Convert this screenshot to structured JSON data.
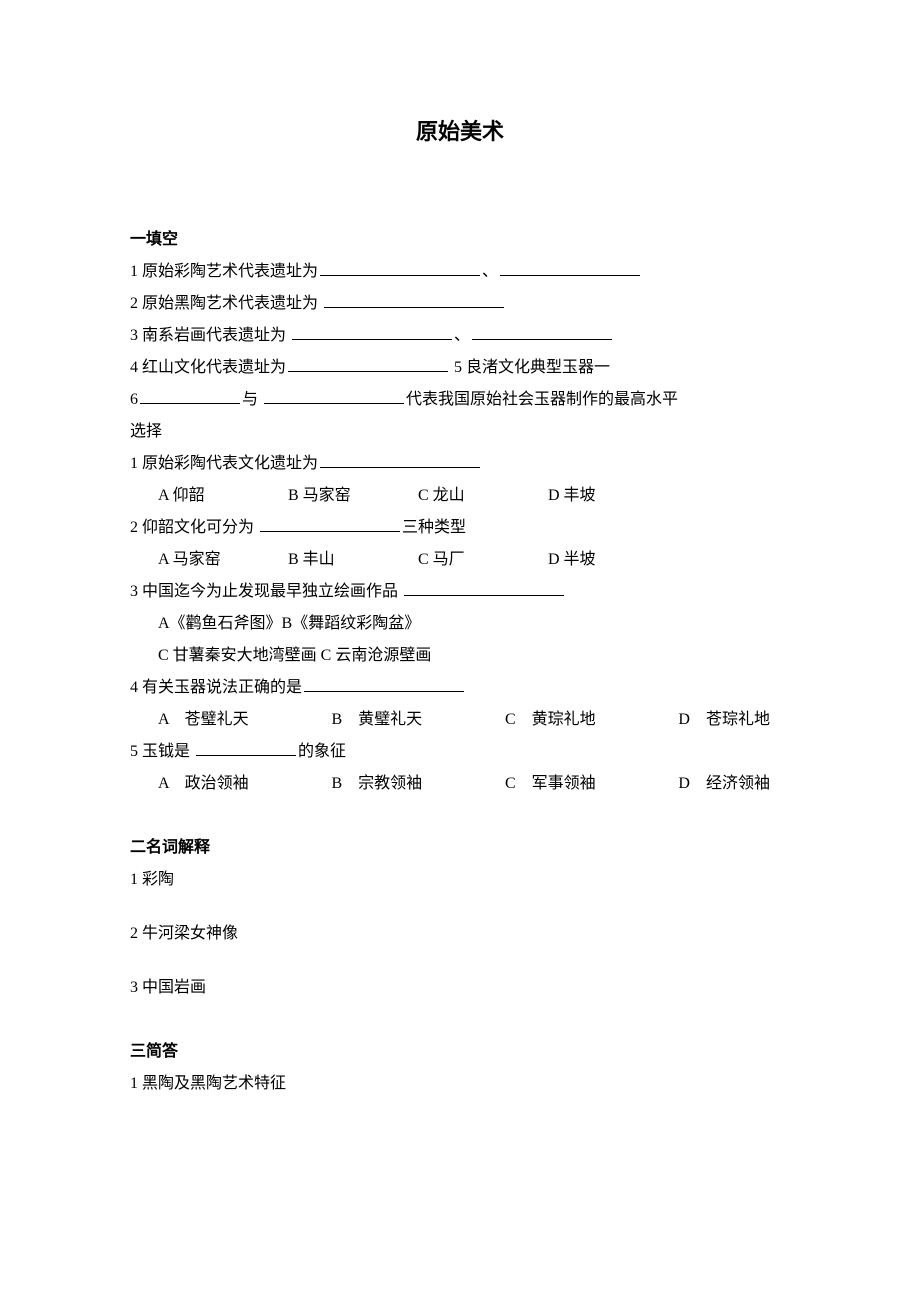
{
  "title": "原始美术",
  "sections": {
    "fill": {
      "heading": "一填空",
      "q1_a": "1 原始彩陶艺术代表遗址为",
      "q1_sep": "、",
      "q2": "2 原始黑陶艺术代表遗址为",
      "q3": "3 南系岩画代表遗址为",
      "q3_sep": "、",
      "q4_a": "4 红山文化代表遗址为",
      "q4_b": "5 良渚文化典型玉器一",
      "q5_a": "6",
      "q5_b": "与",
      "q5_c": "代表我国原始社会玉器制作的最高水平",
      "choice_label": "选择",
      "mc1": "1 原始彩陶代表文化遗址为",
      "mc1_opts": {
        "A": "A 仰韶",
        "B": "B 马家窑",
        "C": "C 龙山",
        "D": "D 丰坡"
      },
      "mc2_a": "2 仰韶文化可分为",
      "mc2_b": "三种类型",
      "mc2_opts": {
        "A": "A 马家窑",
        "B": "B 丰山",
        "C": "C 马厂",
        "D": "D 半坡"
      },
      "mc3": "3 中国迄今为止发现最早独立绘画作品",
      "mc3_line1": "A《鹳鱼石斧图》B《舞蹈纹彩陶盆》",
      "mc3_line2": "C 甘薯秦安大地湾壁画 C 云南沧源壁画",
      "mc4": "4 有关玉器说法正确的是",
      "mc4_opts": {
        "A": "A　苍璧礼天",
        "B": "B　黄璧礼天",
        "C": "C　黄琮礼地",
        "D": "D　苍琮礼地"
      },
      "mc5_a": "5 玉钺是",
      "mc5_b": "的象征",
      "mc5_opts": {
        "A": "A　政治领袖",
        "B": "B　宗教领袖",
        "C": "C　军事领袖",
        "D": "D　经济领袖"
      }
    },
    "terms": {
      "heading": "二名词解释",
      "q1": "1 彩陶",
      "q2": "2 牛河梁女神像",
      "q3": "3 中国岩画"
    },
    "short": {
      "heading": "三简答",
      "q1": "1 黑陶及黑陶艺术特征"
    }
  }
}
